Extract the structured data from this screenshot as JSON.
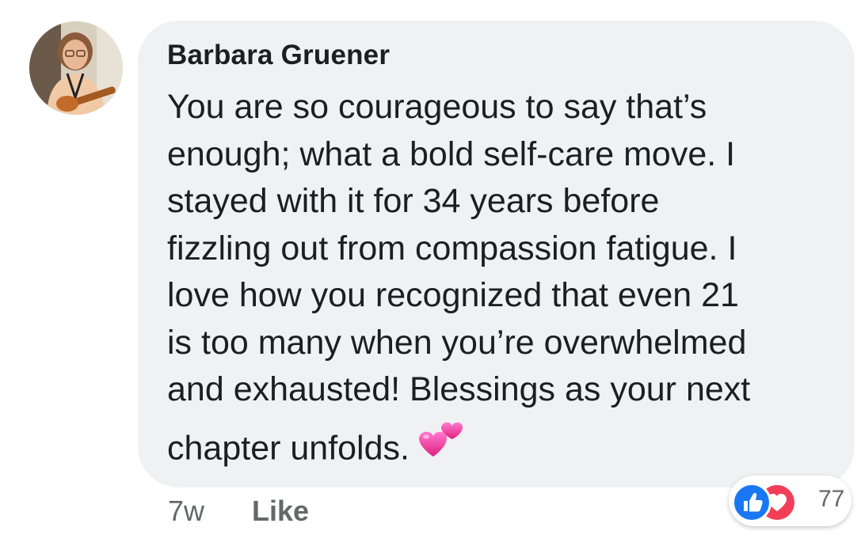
{
  "comment": {
    "author": "Barbara Gruener",
    "text_lines": [
      "You are so courageous to say that’s",
      "enough; what a bold self-care move. I",
      "stayed with it for 34 years before",
      "fizzling out from compassion fatigue. I",
      "love how you recognized that even 21",
      "is too many when you’re overwhelmed",
      "and exhausted! Blessings as your next"
    ],
    "last_line": "chapter unfolds.",
    "emoji": "two-hearts-emoji",
    "timestamp": "7w",
    "like_label": "Like",
    "reactions": {
      "icons": [
        "like-reaction-icon",
        "love-reaction-icon"
      ],
      "count": "77"
    }
  },
  "colors": {
    "bubble_bg": "#f0f1f3",
    "text": "#1c1e21",
    "meta_text": "#65676b",
    "like_blue": "#1877f2",
    "love_red": "#f33e58",
    "heart_pink": "#f24aa6"
  }
}
